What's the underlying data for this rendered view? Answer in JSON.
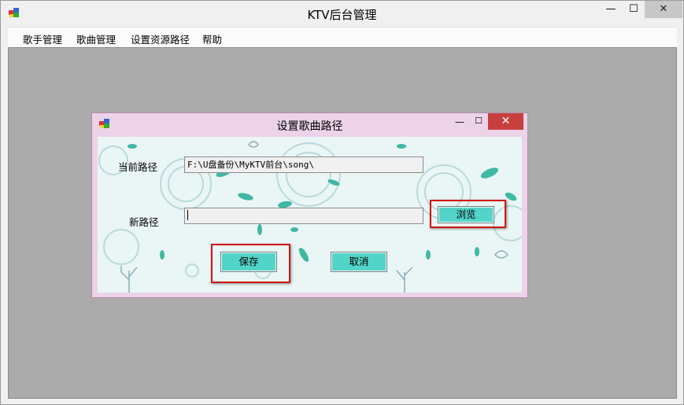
{
  "window": {
    "title": "KTV后台管理",
    "min_glyph": "—",
    "max_glyph": "☐",
    "close_glyph": "✕"
  },
  "menu": [
    {
      "label": "歌手管理"
    },
    {
      "label": "歌曲管理"
    },
    {
      "label": "设置资源路径"
    },
    {
      "label": "帮助"
    }
  ],
  "dialog": {
    "title": "设置歌曲路径",
    "min_glyph": "—",
    "max_glyph": "☐",
    "close_glyph": "✕",
    "current_path_label": "当前路径",
    "current_path_value": "F:\\U盘备份\\MyKTV前台\\song\\",
    "new_path_label": "新路径",
    "new_path_value": "",
    "browse_label": "浏览",
    "save_label": "保存",
    "cancel_label": "取消"
  },
  "colors": {
    "dialog_frame": "#ecd3e8",
    "dialog_client": "#eaf6f5",
    "button_fill": "#53d4c8",
    "close_button": "#c7403e",
    "highlight": "#d21414",
    "mdi_background": "#ababab"
  }
}
